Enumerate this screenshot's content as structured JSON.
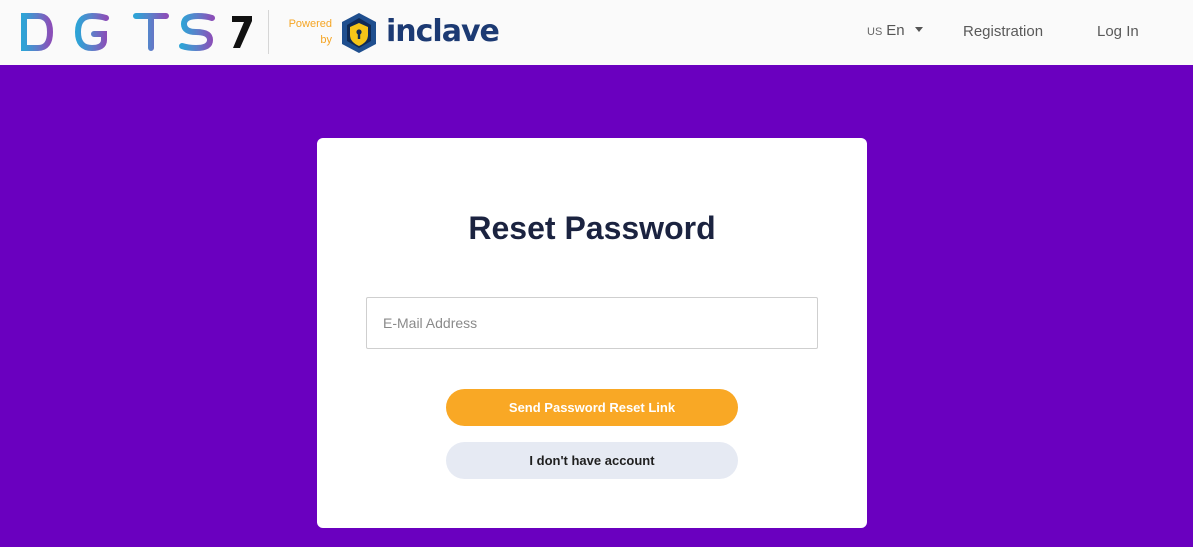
{
  "header": {
    "brand_name": "DIGITS 7",
    "powered_line1": "Powered",
    "powered_line2": "by",
    "partner_name": "inclave",
    "language": {
      "flag": "US",
      "code": "En"
    },
    "nav": {
      "registration": "Registration",
      "login": "Log In"
    }
  },
  "form": {
    "title": "Reset Password",
    "email_placeholder": "E-Mail Address",
    "email_value": "",
    "send_button": "Send Password Reset Link",
    "no_account_button": "I don't have account"
  },
  "colors": {
    "background": "#6a00bf",
    "accent": "#f9a825",
    "secondary_button": "#e6eaf3",
    "title": "#1b2340",
    "logo_blue": "#2ea3d6",
    "logo_purple": "#7b4fb5"
  },
  "icons": {
    "brand": "digits-logo",
    "partner": "inclave-shield-icon",
    "caret": "caret-down-icon"
  }
}
